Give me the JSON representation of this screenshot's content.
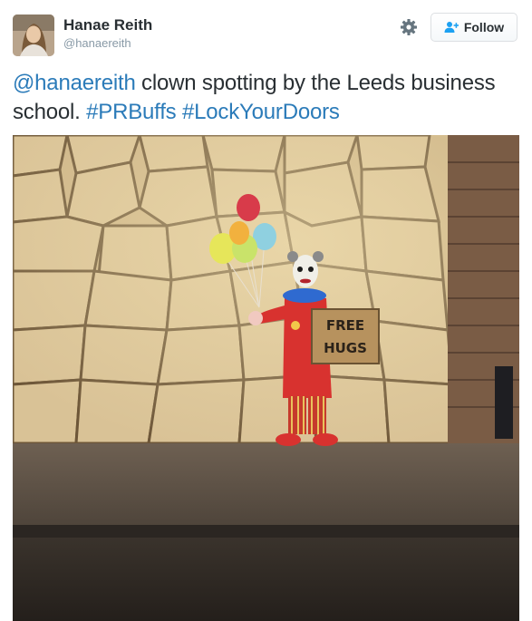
{
  "author": {
    "display_name": "Hanae Reith",
    "handle": "@hanaereith"
  },
  "actions": {
    "follow_label": "Follow",
    "settings_icon": "gear-icon",
    "follow_icon": "add-person-icon"
  },
  "tweet": {
    "mention": "@hanaereith",
    "text_part1": " clown spotting by the Leeds business school. ",
    "hashtag1": "#PRBuffs",
    "text_part2": " ",
    "hashtag2": "#LockYourDoors"
  },
  "media": {
    "sign_line1": "FREE",
    "sign_line2": "HUGS"
  },
  "colors": {
    "link": "#2b7bb9",
    "text": "#292f33",
    "muted": "#8899a6"
  }
}
